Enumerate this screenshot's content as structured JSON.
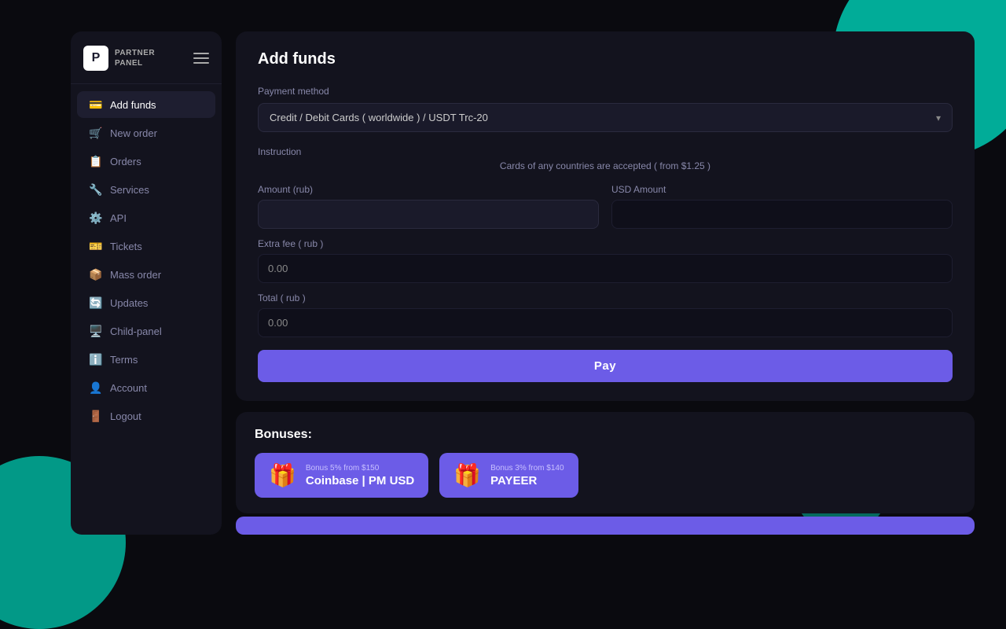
{
  "app": {
    "logo_letter": "P",
    "logo_text_line1": "PARTNER",
    "logo_text_line2": "PANEL"
  },
  "sidebar": {
    "items": [
      {
        "id": "add-funds",
        "label": "Add funds",
        "icon": "💳",
        "active": true
      },
      {
        "id": "new-order",
        "label": "New order",
        "icon": "🛒",
        "active": false
      },
      {
        "id": "orders",
        "label": "Orders",
        "icon": "📋",
        "active": false
      },
      {
        "id": "services",
        "label": "Services",
        "icon": "🔧",
        "active": false
      },
      {
        "id": "api",
        "label": "API",
        "icon": "⚙️",
        "active": false
      },
      {
        "id": "tickets",
        "label": "Tickets",
        "icon": "🎫",
        "active": false
      },
      {
        "id": "mass-order",
        "label": "Mass order",
        "icon": "📦",
        "active": false
      },
      {
        "id": "updates",
        "label": "Updates",
        "icon": "🔄",
        "active": false
      },
      {
        "id": "child-panel",
        "label": "Child-panel",
        "icon": "🖥️",
        "active": false
      },
      {
        "id": "terms",
        "label": "Terms",
        "icon": "ℹ️",
        "active": false
      },
      {
        "id": "account",
        "label": "Account",
        "icon": "👤",
        "active": false
      },
      {
        "id": "logout",
        "label": "Logout",
        "icon": "🚪",
        "active": false
      }
    ]
  },
  "page": {
    "title": "Add funds",
    "payment_method_label": "Payment method",
    "payment_method_value": "Credit / Debit Cards ( worldwide ) / USDT Trc-20",
    "instruction_label": "Instruction",
    "instruction_text": "Cards of any countries are accepted ( from $1.25 )",
    "amount_label": "Amount (rub)",
    "amount_placeholder": "",
    "usd_amount_label": "USD Amount",
    "usd_amount_placeholder": "",
    "extra_fee_label": "Extra fee ( rub )",
    "extra_fee_value": "0.00",
    "total_label": "Total ( rub )",
    "total_value": "0.00",
    "pay_button_label": "Pay"
  },
  "bonuses": {
    "title": "Bonuses:",
    "cards": [
      {
        "id": "coinbase",
        "subtitle": "Bonus 5% from $150",
        "name": "Coinbase | PM USD",
        "icon": "🎁"
      },
      {
        "id": "payeer",
        "subtitle": "Bonus 3% from $140",
        "name": "PAYEER",
        "icon": "🎁"
      }
    ]
  }
}
